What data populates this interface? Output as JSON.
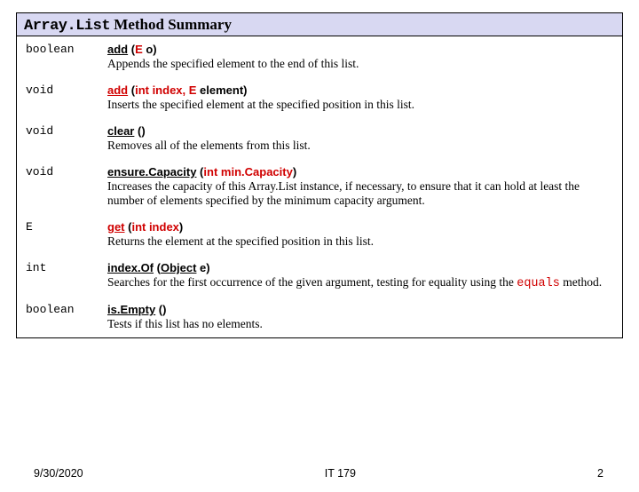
{
  "title_prefix": "Array.List",
  "title_suffix": " Method Summary",
  "rows": [
    {
      "ret": "boolean",
      "sig_html": "<span class='u'>add</span> (<span class='red'>E</span> o)",
      "desc_html": "Appends the specified element to the end of this list."
    },
    {
      "ret": "void",
      "sig_html": "<span class='red u'>add</span> (<span class='red'>int index,</span> <span class='red'>E</span> element)",
      "desc_html": "Inserts the specified element at the specified position in this list."
    },
    {
      "ret": "void",
      "sig_html": "<span class='u'>clear</span> ()",
      "desc_html": "Removes all of the elements from this list."
    },
    {
      "ret": "void",
      "sig_html": "<span class='u'>ensure.Capacity</span> (<span class='red'>int</span> <span class='red'>min.Capacity</span>)",
      "desc_html": "Increases the capacity of this Array.List  instance, if necessary, to ensure that it can hold at least the number of elements specified by the minimum capacity argument."
    },
    {
      "ret": "E",
      "sig_html": "<span class='red u'>get</span> (<span class='red'>int index</span>)",
      "desc_html": "Returns the element at the specified position in this list."
    },
    {
      "ret": "int",
      "sig_html": "<span class='u'>index.Of</span> (<span class='u'>Object</span> e)",
      "desc_html": "Searches for the first occurrence of the given argument, testing for equality using the <span class='codered'>equals</span>  method."
    },
    {
      "ret": "boolean",
      "sig_html": "<span class='u'>is.Empty</span> ()",
      "desc_html": "Tests if this list has no elements."
    }
  ],
  "footer": {
    "date": "9/30/2020",
    "center": "IT 179",
    "page": "2"
  }
}
